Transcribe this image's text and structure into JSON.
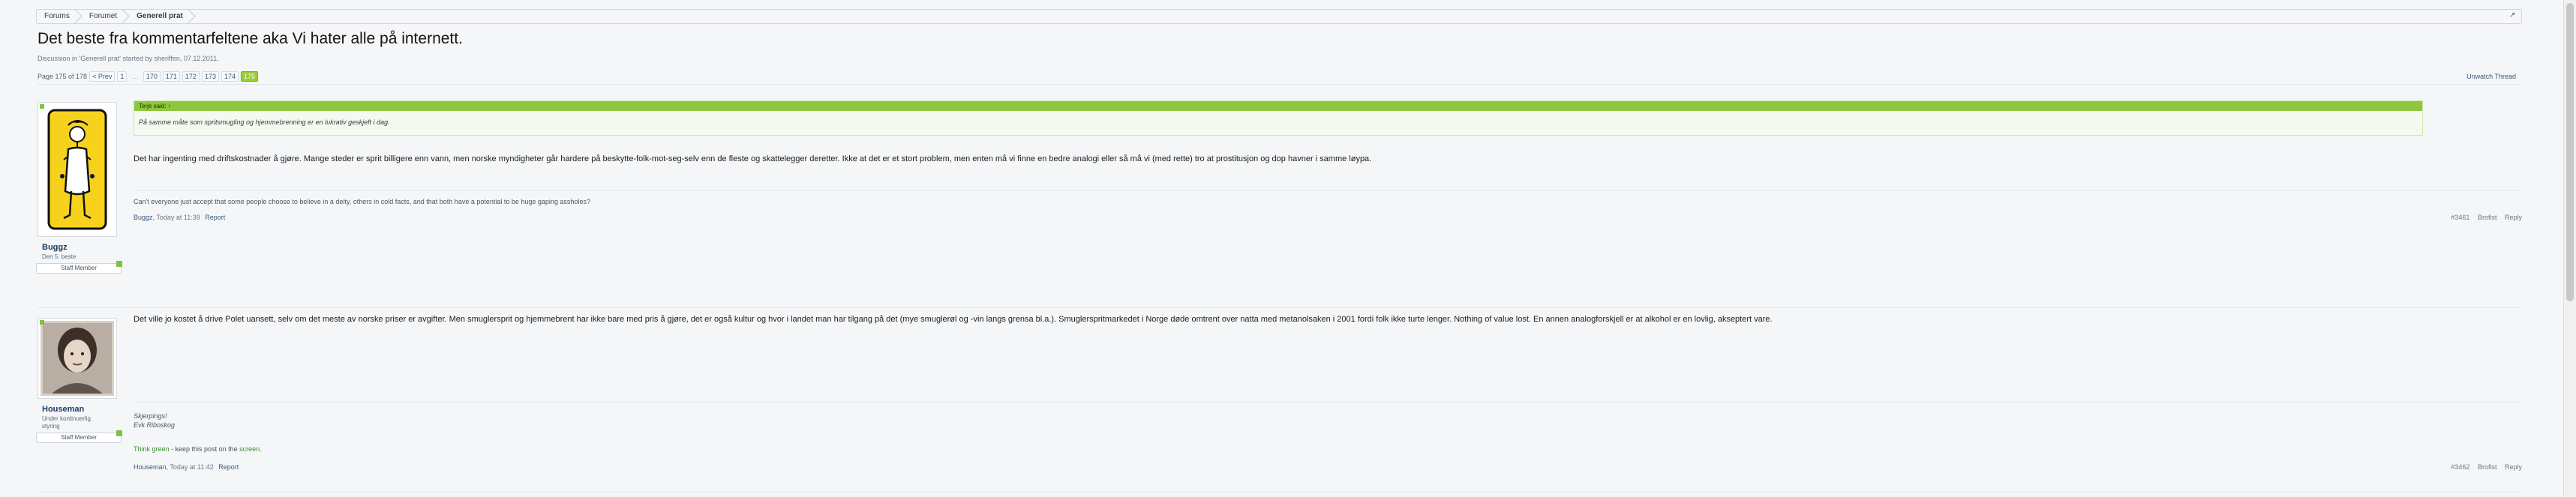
{
  "breadcrumb": {
    "items": [
      {
        "label": "Forums"
      },
      {
        "label": "Forumet"
      },
      {
        "label": "Generell prat"
      }
    ],
    "jump_icon": "external-arrow-icon"
  },
  "thread": {
    "title": "Det beste fra kommentarfeltene aka Vi hater alle på internett.",
    "description": "Discussion in 'Generell prat' started by sheriffen, 07.12.2011."
  },
  "pagination": {
    "label": "Page 175 of 178",
    "prev": "< Prev",
    "first": "1",
    "ellipsis": "...",
    "pages": [
      "170",
      "171",
      "172",
      "173",
      "174",
      "175"
    ],
    "current": "175"
  },
  "unwatch": "Unwatch Thread",
  "posts": [
    {
      "username": "Buggz",
      "user_title": "Den 5. beste",
      "staff": "Staff Member",
      "quote_author": "Terje said: ↑",
      "quote_text": "På samme måte som spritsmugling og hjemmebrenning er en lukrativ geskjeft i dag.",
      "message": "Det har ingenting med driftskostnader å gjøre. Mange steder er sprit billigere enn vann, men norske myndigheter går hardere på beskytte-folk-mot-seg-selv enn de fleste og skattelegger deretter. Ikke at det er et stort problem, men enten må vi finne en bedre analogi eller så må vi (med rette) tro at prostitusjon og dop havner i samme løypa.",
      "signature": "Can't everyone just accept that some people choose to believe in a deity, others in cold facts, and that both have a potential to be huge gaping assholes?",
      "meta_author": "Buggz,",
      "meta_time": "Today at 11:39",
      "meta_report": "Report",
      "number": "#3461",
      "brofist": "Brofist",
      "reply": "Reply"
    },
    {
      "username": "Houseman",
      "user_title": "Under kontinuerlig styring",
      "staff": "Staff Member",
      "message": "Det ville jo kostet å drive Polet uansett, selv om det meste av norske priser er avgifter. Men smuglersprit og hjemmebrent har ikke bare med pris å gjøre, det er også kultur og hvor i landet man har tilgang på det (mye smuglerøl og -vin langs grensa bl.a.). Smuglerspritmarkedet i Norge døde omtrent over natta med metanolsaken i 2001 fordi folk ikke turte lenger. Nothing of value lost. En annen analogforskjell er at alkohol er en lovlig, akseptert vare.",
      "sig_line1": "Skjerpings!",
      "sig_line2": "Evk Riboskog",
      "sig_green_1": "Think green",
      "sig_mid": " - keep this post on the ",
      "sig_green_2": "screen",
      "sig_end": ".",
      "meta_author": "Houseman,",
      "meta_time": "Today at 11:42",
      "meta_report": "Report",
      "number": "#3462",
      "brofist": "Brofist",
      "reply": "Reply"
    }
  ],
  "colors": {
    "accent_green": "#8ec63f",
    "link_blue": "#3c5a78",
    "title_dark": "#141414"
  }
}
